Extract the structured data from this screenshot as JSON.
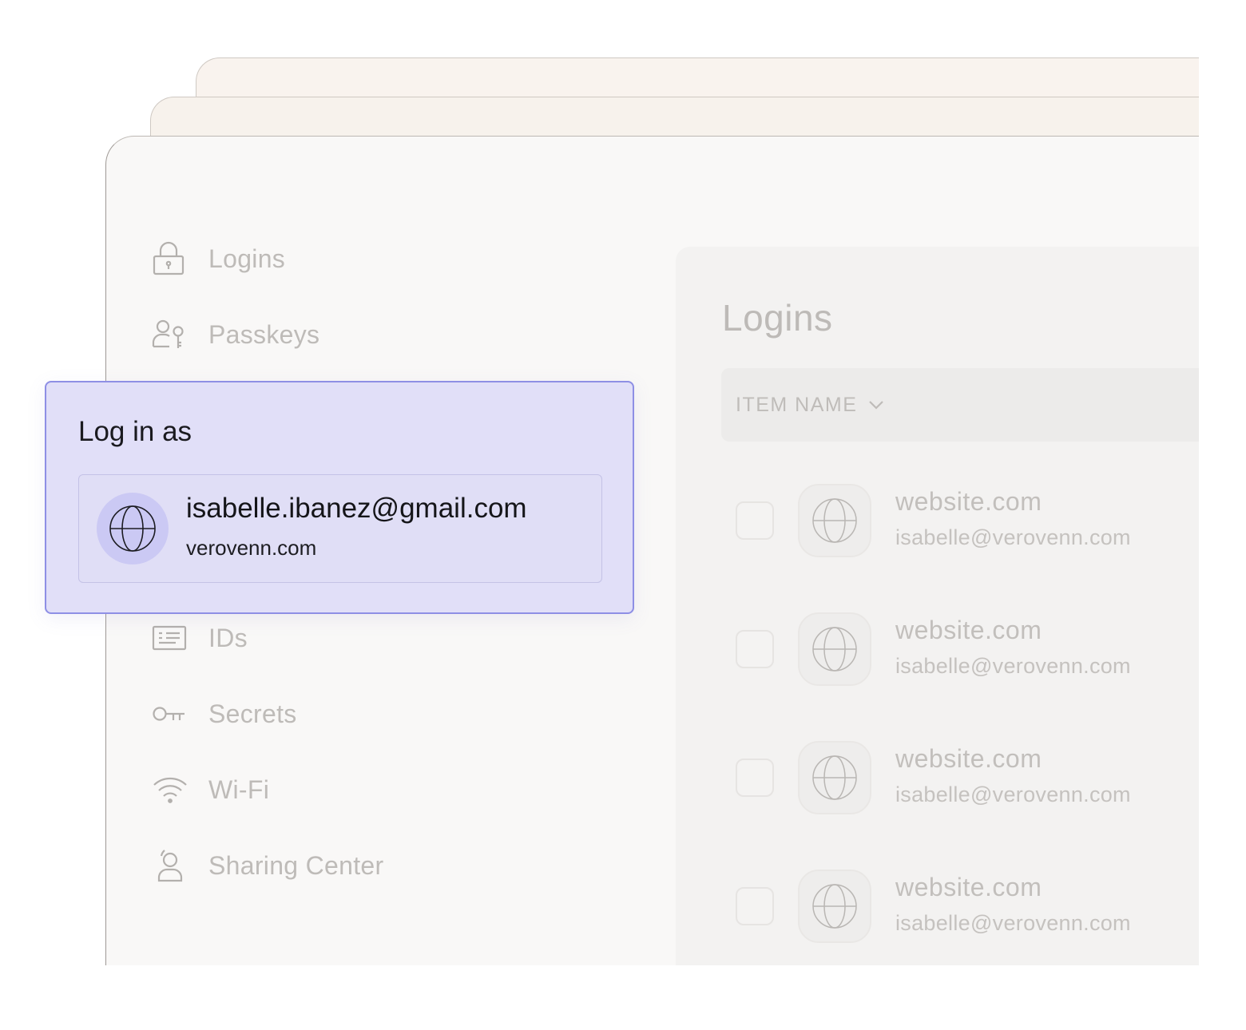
{
  "sidebar": {
    "items": [
      {
        "label": "Logins",
        "icon": "lock-icon"
      },
      {
        "label": "Passkeys",
        "icon": "passkey-icon"
      },
      {
        "label": "IDs",
        "icon": "id-card-icon"
      },
      {
        "label": "Secrets",
        "icon": "key-icon"
      },
      {
        "label": "Wi-Fi",
        "icon": "wifi-icon"
      },
      {
        "label": "Sharing Center",
        "icon": "sharing-icon"
      }
    ]
  },
  "main": {
    "title": "Logins",
    "column_header": "ITEM NAME",
    "rows": [
      {
        "name": "website.com",
        "username": "isabelle@verovenn.com"
      },
      {
        "name": "website.com",
        "username": "isabelle@verovenn.com"
      },
      {
        "name": "website.com",
        "username": "isabelle@verovenn.com"
      },
      {
        "name": "website.com",
        "username": "isabelle@verovenn.com"
      }
    ]
  },
  "popup": {
    "title": "Log in as",
    "option": {
      "email": "isabelle.ibanez@gmail.com",
      "domain": "verovenn.com",
      "icon": "globe-icon"
    }
  },
  "colors": {
    "popup_background": "#e1dff8",
    "popup_border": "#8e8fe5",
    "popup_avatar": "#cbc9f4",
    "window_background": "#f9f8f7",
    "back_card": "#f9f3ee"
  }
}
